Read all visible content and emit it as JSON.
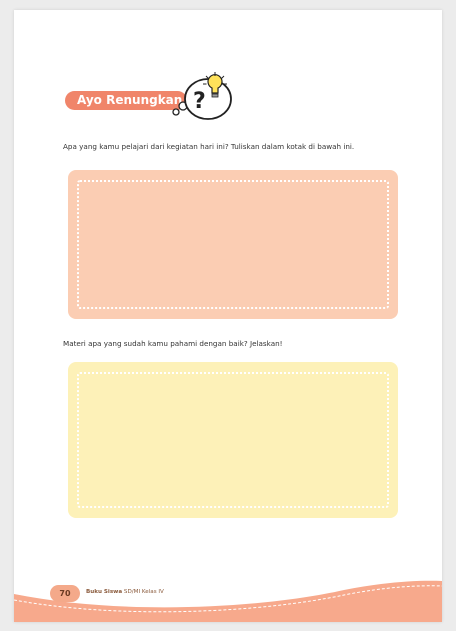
{
  "section": {
    "title": "Ayo Renungkan",
    "icon": "thinking-bubble-lightbulb-icon"
  },
  "questions": [
    {
      "text": "Apa yang kamu pelajari dari kegiatan hari ini? Tuliskan dalam kotak di bawah ini."
    },
    {
      "text": "Materi apa yang sudah kamu pahami dengan baik? Jelaskan!"
    }
  ],
  "footer": {
    "page_number": "70",
    "book_bold": "Buku Siswa",
    "book_rest": " SD/MI Kelas IV"
  },
  "colors": {
    "accent": "#f0856a",
    "box1": "#fbcdb3",
    "box2": "#fdf1b8",
    "footer": "#f7a98c"
  }
}
